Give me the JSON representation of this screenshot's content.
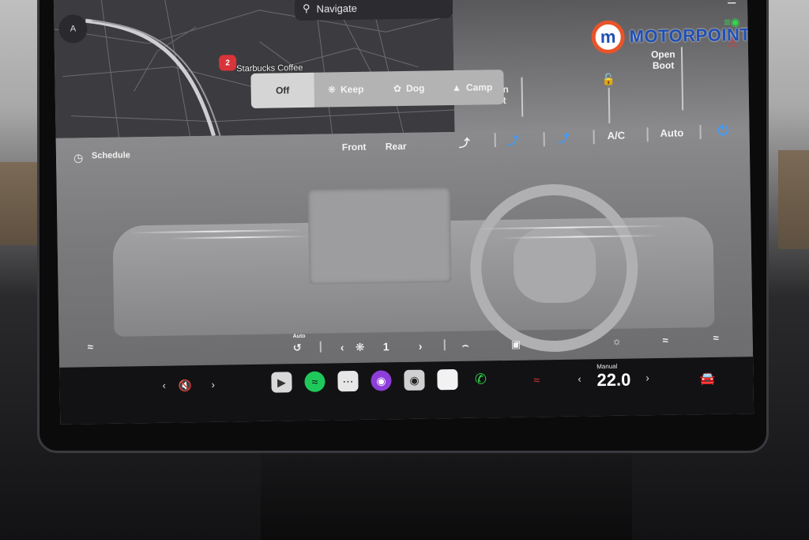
{
  "map": {
    "search_label": "Navigate",
    "poi_badge": "2",
    "poi_label": "Starbucks Coffee",
    "compass_letter": "A"
  },
  "top_right": {
    "open_boot": "Open\nBoot",
    "partial_label": "en\net"
  },
  "branding": {
    "logo_letter": "m",
    "logo_text": "MOTORPOINT",
    "logo_color": "#1e4fb5",
    "logo_ring_color": "#e8542a"
  },
  "modes": {
    "items": [
      {
        "label": "Off",
        "icon": "",
        "active": true
      },
      {
        "label": "Keep",
        "icon": "fan-icon",
        "active": false
      },
      {
        "label": "Dog",
        "icon": "paw-icon",
        "active": false
      },
      {
        "label": "Camp",
        "icon": "tent-icon",
        "active": false
      }
    ]
  },
  "climate": {
    "schedule_label": "Schedule",
    "front_label": "Front",
    "rear_label": "Rear",
    "ac_label": "A/C",
    "auto_label": "Auto",
    "recirc_auto_label": "Auto",
    "fan_speed": "1",
    "power_color": "#3c9bff"
  },
  "taskbar": {
    "temp_mode": "Manual",
    "temperature": "22.0"
  }
}
